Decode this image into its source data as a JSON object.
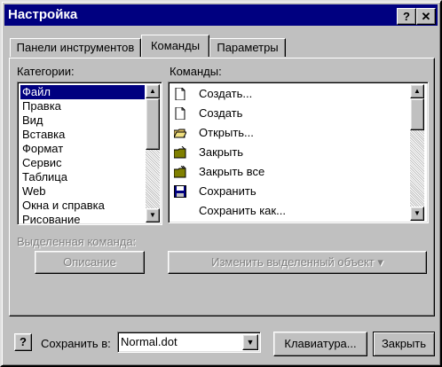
{
  "window": {
    "title": "Настройка",
    "help_btn": "?",
    "close_btn": "✕"
  },
  "tabs": [
    "Панели инструментов",
    "Команды",
    "Параметры"
  ],
  "categories": {
    "label": "Категории:",
    "items": [
      "Файл",
      "Правка",
      "Вид",
      "Вставка",
      "Формат",
      "Сервис",
      "Таблица",
      "Web",
      "Окна и справка",
      "Рисование"
    ],
    "selected_index": 0
  },
  "commands": {
    "label": "Команды:",
    "items": [
      {
        "label": "Создать...",
        "icon": "new-document-icon"
      },
      {
        "label": "Создать",
        "icon": "new-document-icon"
      },
      {
        "label": "Открыть...",
        "icon": "open-folder-icon"
      },
      {
        "label": "Закрыть",
        "icon": "close-folder-icon"
      },
      {
        "label": "Закрыть все",
        "icon": "close-all-folder-icon"
      },
      {
        "label": "Сохранить",
        "icon": "floppy-disk-icon"
      },
      {
        "label": "Сохранить как...",
        "icon": ""
      }
    ]
  },
  "selected_command": {
    "label": "Выделенная команда:",
    "description_btn": "Описание",
    "modify_btn": "Изменить выделенный объект ▾"
  },
  "footer": {
    "help_icon": "?",
    "save_in_label": "Сохранить в:",
    "save_in_value": "Normal.dot",
    "keyboard_btn": "Клавиатура...",
    "close_btn": "Закрыть"
  }
}
